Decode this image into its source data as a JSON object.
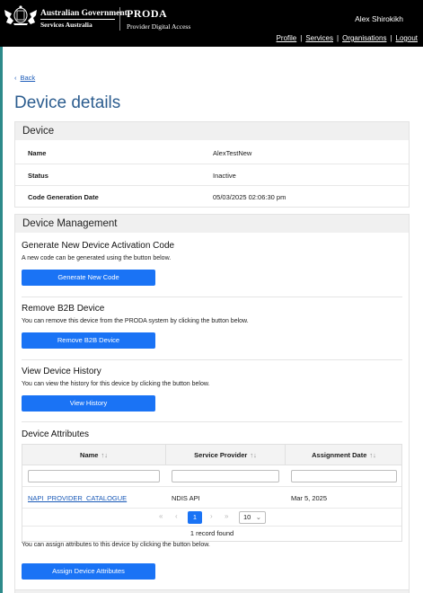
{
  "header": {
    "gov_line1": "Australian Government",
    "gov_line2": "Services Australia",
    "app_name": "PRODA",
    "app_sub": "Provider Digital Access",
    "username": "Alex Shirokikh",
    "nav": [
      "Profile",
      "Services",
      "Organisations",
      "Logout"
    ]
  },
  "back_label": "Back",
  "page_title": "Device details",
  "device": {
    "heading": "Device",
    "rows": [
      {
        "label": "Name",
        "value": "AlexTestNew"
      },
      {
        "label": "Status",
        "value": "Inactive"
      },
      {
        "label": "Code Generation Date",
        "value": "05/03/2025 02:06:30 pm"
      }
    ]
  },
  "management": {
    "heading": "Device Management",
    "generate": {
      "title": "Generate New Device Activation Code",
      "desc": "A new code can be generated using the button below.",
      "button": "Generate New Code"
    },
    "remove": {
      "title": "Remove B2B Device",
      "desc": "You can remove this device from the PRODA system by clicking the button below.",
      "button": "Remove B2B Device"
    },
    "history": {
      "title": "View Device History",
      "desc": "You can view the history for this device by clicking the button below.",
      "button": "View History"
    },
    "attributes": {
      "title": "Device Attributes",
      "columns": [
        "Name",
        "Service Provider",
        "Assignment Date"
      ],
      "rows": [
        {
          "name": "NAPI_PROVIDER_CATALOGUE",
          "provider": "NDIS API",
          "date": "Mar 5, 2025"
        }
      ],
      "pager": {
        "current": "1",
        "page_size": "10"
      },
      "found": "1 record found",
      "desc": "You can assign attributes to this device by clicking the button below.",
      "button": "Assign Device Attributes"
    }
  },
  "colors": {
    "accent": "#1a73f5",
    "header_bg": "#000000",
    "title": "#2c5d8f",
    "side_line": "#2d8a8a"
  },
  "icons": [
    "crest-icon",
    "chevron-left-icon",
    "sort-icon",
    "first-page-icon",
    "prev-page-icon",
    "next-page-icon",
    "last-page-icon",
    "chevron-down-icon"
  ]
}
